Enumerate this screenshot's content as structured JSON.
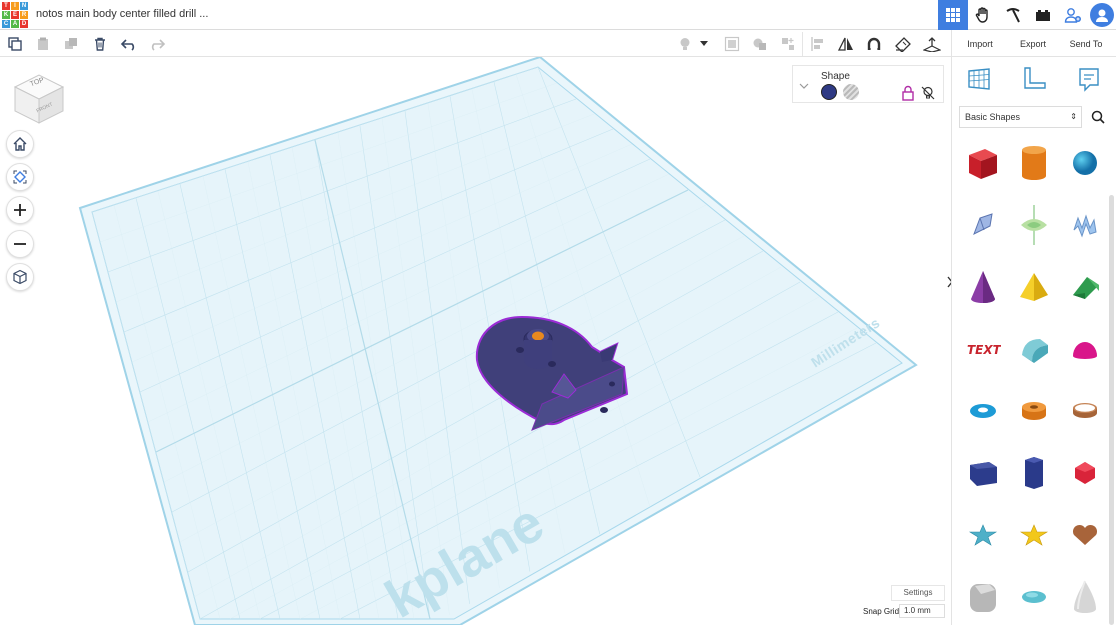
{
  "app": {
    "title": "notos main body center filled drill ...",
    "logo_letters": [
      "TIN",
      "KER",
      "CAD"
    ]
  },
  "topbar": {
    "icons": [
      "grid-view-icon",
      "hand-icon",
      "pickaxe-icon",
      "bricks-icon",
      "add-user-icon",
      "user-avatar-icon"
    ]
  },
  "toolbar": {
    "tools": [
      "copy-icon",
      "paste-icon",
      "duplicate-icon",
      "delete-icon",
      "undo-icon",
      "redo-icon"
    ],
    "view_tools": [
      "light-bulb-icon",
      "dropdown-icon",
      "group-icon",
      "ungroup-icon",
      "align-icon",
      "mirror-icon",
      "magnet-icon",
      "ruler-icon",
      "workplane-icon",
      "cruise-icon"
    ],
    "import_label": "Import",
    "export_label": "Export",
    "send_to_label": "Send To"
  },
  "viewcube": {
    "top_label": "TOP",
    "front_label": "FRONT"
  },
  "shape_panel": {
    "title": "Shape",
    "solid_color": "#2f3a84",
    "hole_color": "#b9b9b9"
  },
  "workplane": {
    "units_label": "Millimeters",
    "watermark": "kplane",
    "settings_label": "Settings",
    "snap_grid_label": "Snap Grid",
    "snap_grid_value": "1.0 mm"
  },
  "library": {
    "selected": "Basic Shapes",
    "shapes": [
      {
        "name": "box",
        "color": "#d8242f"
      },
      {
        "name": "cylinder",
        "color": "#e57c1f"
      },
      {
        "name": "sphere",
        "color": "#1a9ed0"
      },
      {
        "name": "scribble",
        "color": "#8ea6d8"
      },
      {
        "name": "shape-generator",
        "color": "#8fd08a"
      },
      {
        "name": "text-shape",
        "color": "#8cb4e8"
      },
      {
        "name": "cone",
        "color": "#8a3ea6"
      },
      {
        "name": "pyramid",
        "color": "#f2c81b"
      },
      {
        "name": "roof",
        "color": "#2a9d4b"
      },
      {
        "name": "text",
        "color": "#cf2b2b"
      },
      {
        "name": "round-roof",
        "color": "#5bbfcf"
      },
      {
        "name": "half-sphere",
        "color": "#d81b8a"
      },
      {
        "name": "torus",
        "color": "#1f9fd6"
      },
      {
        "name": "tube",
        "color": "#e57c1f"
      },
      {
        "name": "ring",
        "color": "#a8643a"
      },
      {
        "name": "wedge-box",
        "color": "#2c3c8c"
      },
      {
        "name": "hexagonal-prism",
        "color": "#2c3c8c"
      },
      {
        "name": "polyhedron",
        "color": "#d8242f"
      },
      {
        "name": "star",
        "color": "#5bbfcf"
      },
      {
        "name": "star-5",
        "color": "#f2c81b"
      },
      {
        "name": "heart",
        "color": "#a8643a"
      },
      {
        "name": "rounded-box",
        "color": "#b5b5b5"
      },
      {
        "name": "ellipsoid",
        "color": "#5bbfcf"
      },
      {
        "name": "paraboloid",
        "color": "#d0d0d0"
      }
    ]
  }
}
